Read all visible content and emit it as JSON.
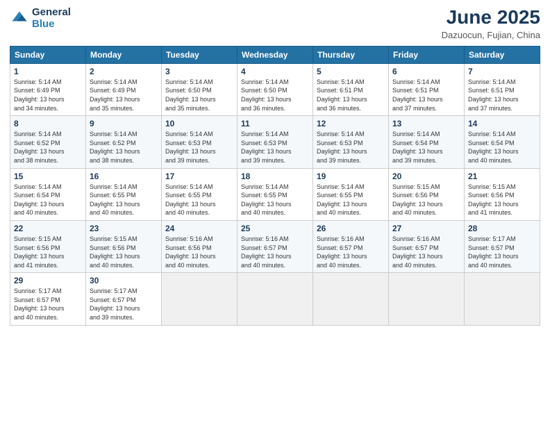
{
  "logo": {
    "line1": "General",
    "line2": "Blue"
  },
  "title": "June 2025",
  "location": "Dazuocun, Fujian, China",
  "weekdays": [
    "Sunday",
    "Monday",
    "Tuesday",
    "Wednesday",
    "Thursday",
    "Friday",
    "Saturday"
  ],
  "weeks": [
    [
      {
        "day": 1,
        "rise": "5:14 AM",
        "set": "6:49 PM",
        "hours": "13",
        "mins": "34"
      },
      {
        "day": 2,
        "rise": "5:14 AM",
        "set": "6:49 PM",
        "hours": "13",
        "mins": "35"
      },
      {
        "day": 3,
        "rise": "5:14 AM",
        "set": "6:50 PM",
        "hours": "13",
        "mins": "35"
      },
      {
        "day": 4,
        "rise": "5:14 AM",
        "set": "6:50 PM",
        "hours": "13",
        "mins": "36"
      },
      {
        "day": 5,
        "rise": "5:14 AM",
        "set": "6:51 PM",
        "hours": "13",
        "mins": "36"
      },
      {
        "day": 6,
        "rise": "5:14 AM",
        "set": "6:51 PM",
        "hours": "13",
        "mins": "37"
      },
      {
        "day": 7,
        "rise": "5:14 AM",
        "set": "6:51 PM",
        "hours": "13",
        "mins": "37"
      }
    ],
    [
      {
        "day": 8,
        "rise": "5:14 AM",
        "set": "6:52 PM",
        "hours": "13",
        "mins": "38"
      },
      {
        "day": 9,
        "rise": "5:14 AM",
        "set": "6:52 PM",
        "hours": "13",
        "mins": "38"
      },
      {
        "day": 10,
        "rise": "5:14 AM",
        "set": "6:53 PM",
        "hours": "13",
        "mins": "39"
      },
      {
        "day": 11,
        "rise": "5:14 AM",
        "set": "6:53 PM",
        "hours": "13",
        "mins": "39"
      },
      {
        "day": 12,
        "rise": "5:14 AM",
        "set": "6:53 PM",
        "hours": "13",
        "mins": "39"
      },
      {
        "day": 13,
        "rise": "5:14 AM",
        "set": "6:54 PM",
        "hours": "13",
        "mins": "39"
      },
      {
        "day": 14,
        "rise": "5:14 AM",
        "set": "6:54 PM",
        "hours": "13",
        "mins": "40"
      }
    ],
    [
      {
        "day": 15,
        "rise": "5:14 AM",
        "set": "6:54 PM",
        "hours": "13",
        "mins": "40"
      },
      {
        "day": 16,
        "rise": "5:14 AM",
        "set": "6:55 PM",
        "hours": "13",
        "mins": "40"
      },
      {
        "day": 17,
        "rise": "5:14 AM",
        "set": "6:55 PM",
        "hours": "13",
        "mins": "40"
      },
      {
        "day": 18,
        "rise": "5:14 AM",
        "set": "6:55 PM",
        "hours": "13",
        "mins": "40"
      },
      {
        "day": 19,
        "rise": "5:14 AM",
        "set": "6:55 PM",
        "hours": "13",
        "mins": "40"
      },
      {
        "day": 20,
        "rise": "5:15 AM",
        "set": "6:56 PM",
        "hours": "13",
        "mins": "40"
      },
      {
        "day": 21,
        "rise": "5:15 AM",
        "set": "6:56 PM",
        "hours": "13",
        "mins": "41"
      }
    ],
    [
      {
        "day": 22,
        "rise": "5:15 AM",
        "set": "6:56 PM",
        "hours": "13",
        "mins": "41"
      },
      {
        "day": 23,
        "rise": "5:15 AM",
        "set": "6:56 PM",
        "hours": "13",
        "mins": "40"
      },
      {
        "day": 24,
        "rise": "5:16 AM",
        "set": "6:56 PM",
        "hours": "13",
        "mins": "40"
      },
      {
        "day": 25,
        "rise": "5:16 AM",
        "set": "6:57 PM",
        "hours": "13",
        "mins": "40"
      },
      {
        "day": 26,
        "rise": "5:16 AM",
        "set": "6:57 PM",
        "hours": "13",
        "mins": "40"
      },
      {
        "day": 27,
        "rise": "5:16 AM",
        "set": "6:57 PM",
        "hours": "13",
        "mins": "40"
      },
      {
        "day": 28,
        "rise": "5:17 AM",
        "set": "6:57 PM",
        "hours": "13",
        "mins": "40"
      }
    ],
    [
      {
        "day": 29,
        "rise": "5:17 AM",
        "set": "6:57 PM",
        "hours": "13",
        "mins": "40"
      },
      {
        "day": 30,
        "rise": "5:17 AM",
        "set": "6:57 PM",
        "hours": "13",
        "mins": "39"
      },
      null,
      null,
      null,
      null,
      null
    ]
  ]
}
